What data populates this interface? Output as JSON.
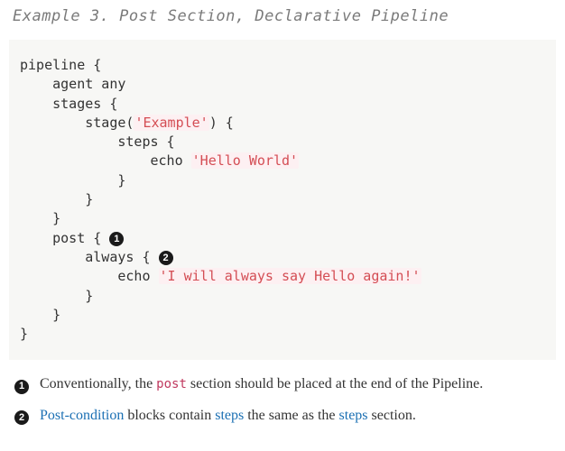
{
  "title": "Example 3. Post Section, Declarative Pipeline",
  "code": {
    "l1": "pipeline {",
    "l2": "    agent any",
    "l3": "    stages {",
    "l4": "        stage(",
    "l4s": "'Example'",
    "l4e": ") {",
    "l5": "            steps {",
    "l6": "                echo ",
    "l6s": "'Hello World'",
    "l7": "            }",
    "l8": "        }",
    "l9": "    }",
    "l10": "    post { ",
    "l11": "        always { ",
    "l12": "            echo ",
    "l12s": "'I will always say Hello again!'",
    "l13": "        }",
    "l14": "    }",
    "l15": "}"
  },
  "callouts": {
    "n1": "1",
    "n2": "2"
  },
  "legend": {
    "item1_pre": "Conventionally, the ",
    "item1_code": "post",
    "item1_post": " section should be placed at the end of the Pipeline.",
    "item2_link1": "Post-condition",
    "item2_mid1": " blocks contain ",
    "item2_link2": "steps",
    "item2_mid2": " the same as the ",
    "item2_link3": "steps",
    "item2_end": " section."
  }
}
